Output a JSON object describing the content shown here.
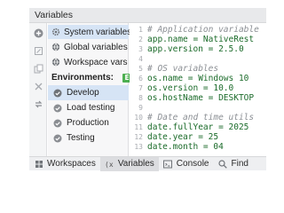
{
  "panel": {
    "title": "Variables"
  },
  "toolstrip": {
    "icons": [
      "add-icon",
      "edit-icon",
      "copy-icon",
      "delete-icon",
      "refresh-icon"
    ]
  },
  "sidebar": {
    "scopes": [
      {
        "label": "System variables",
        "badge": "S",
        "badge_color": "#8fa6d9",
        "icon": "gear-icon"
      },
      {
        "label": "Global variables",
        "badge": "G",
        "badge_color": "#9b7fd1",
        "icon": "globe-icon"
      },
      {
        "label": "Workspace vars",
        "badge": "W",
        "badge_color": "#e8935a",
        "icon": "globe-icon"
      }
    ],
    "environments_label": "Environments:",
    "environments_badge": "E",
    "environments_badge_color": "#4caf50",
    "environments": [
      {
        "label": "Develop",
        "active": true
      },
      {
        "label": "Load testing",
        "active": false
      },
      {
        "label": "Production",
        "active": false
      },
      {
        "label": "Testing",
        "active": false
      }
    ]
  },
  "editor": {
    "lines": [
      {
        "n": "1",
        "text": "# Application variable",
        "kind": "comment"
      },
      {
        "n": "2",
        "text": "app.name = NativeRest",
        "kind": "code"
      },
      {
        "n": "3",
        "text": "app.version = 2.5.0",
        "kind": "code"
      },
      {
        "n": "4",
        "text": "",
        "kind": "code"
      },
      {
        "n": "5",
        "text": "# OS variables",
        "kind": "comment"
      },
      {
        "n": "6",
        "text": "os.name = Windows 10",
        "kind": "code"
      },
      {
        "n": "7",
        "text": "os.version = 10.0",
        "kind": "code"
      },
      {
        "n": "8",
        "text": "os.hostName = DESKTOP",
        "kind": "code"
      },
      {
        "n": "9",
        "text": "",
        "kind": "code"
      },
      {
        "n": "10",
        "text": "# Date and time utils",
        "kind": "comment"
      },
      {
        "n": "11",
        "text": "date.fullYear = 2025",
        "kind": "code"
      },
      {
        "n": "12",
        "text": "date.year = 25",
        "kind": "code"
      },
      {
        "n": "13",
        "text": "date.month = 04",
        "kind": "code"
      }
    ]
  },
  "bottom_tabs": [
    {
      "label": "Workspaces",
      "icon": "workspaces-icon",
      "active": false
    },
    {
      "label": "Variables",
      "icon": "variables-icon",
      "active": true
    },
    {
      "label": "Console",
      "icon": "console-icon",
      "active": false
    },
    {
      "label": "Find",
      "icon": "search-icon",
      "active": false
    }
  ]
}
